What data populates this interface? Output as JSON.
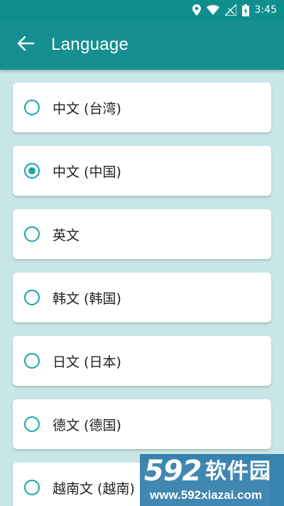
{
  "status_bar": {
    "time": "3:45",
    "icons": [
      "location-icon",
      "wifi-icon",
      "signal-icon",
      "battery-charging-icon"
    ]
  },
  "app_bar": {
    "title": "Language",
    "back_icon": "arrow-left-icon"
  },
  "colors": {
    "status_bar": "#0f8e8e",
    "app_bar": "#158f91",
    "background": "#c9e6e6",
    "accent": "#17a5a8",
    "card": "#ffffff"
  },
  "languages": [
    {
      "label": "中文 (台湾)",
      "selected": false
    },
    {
      "label": "中文 (中国)",
      "selected": true
    },
    {
      "label": "英文",
      "selected": false
    },
    {
      "label": "韩文 (韩国)",
      "selected": false
    },
    {
      "label": "日文 (日本)",
      "selected": false
    },
    {
      "label": "德文 (德国)",
      "selected": false
    },
    {
      "label": "越南文 (越南)",
      "selected": false
    }
  ],
  "watermark": {
    "logo_number": "592",
    "site_name": "软件园",
    "url": "www.592xiazai.com"
  }
}
